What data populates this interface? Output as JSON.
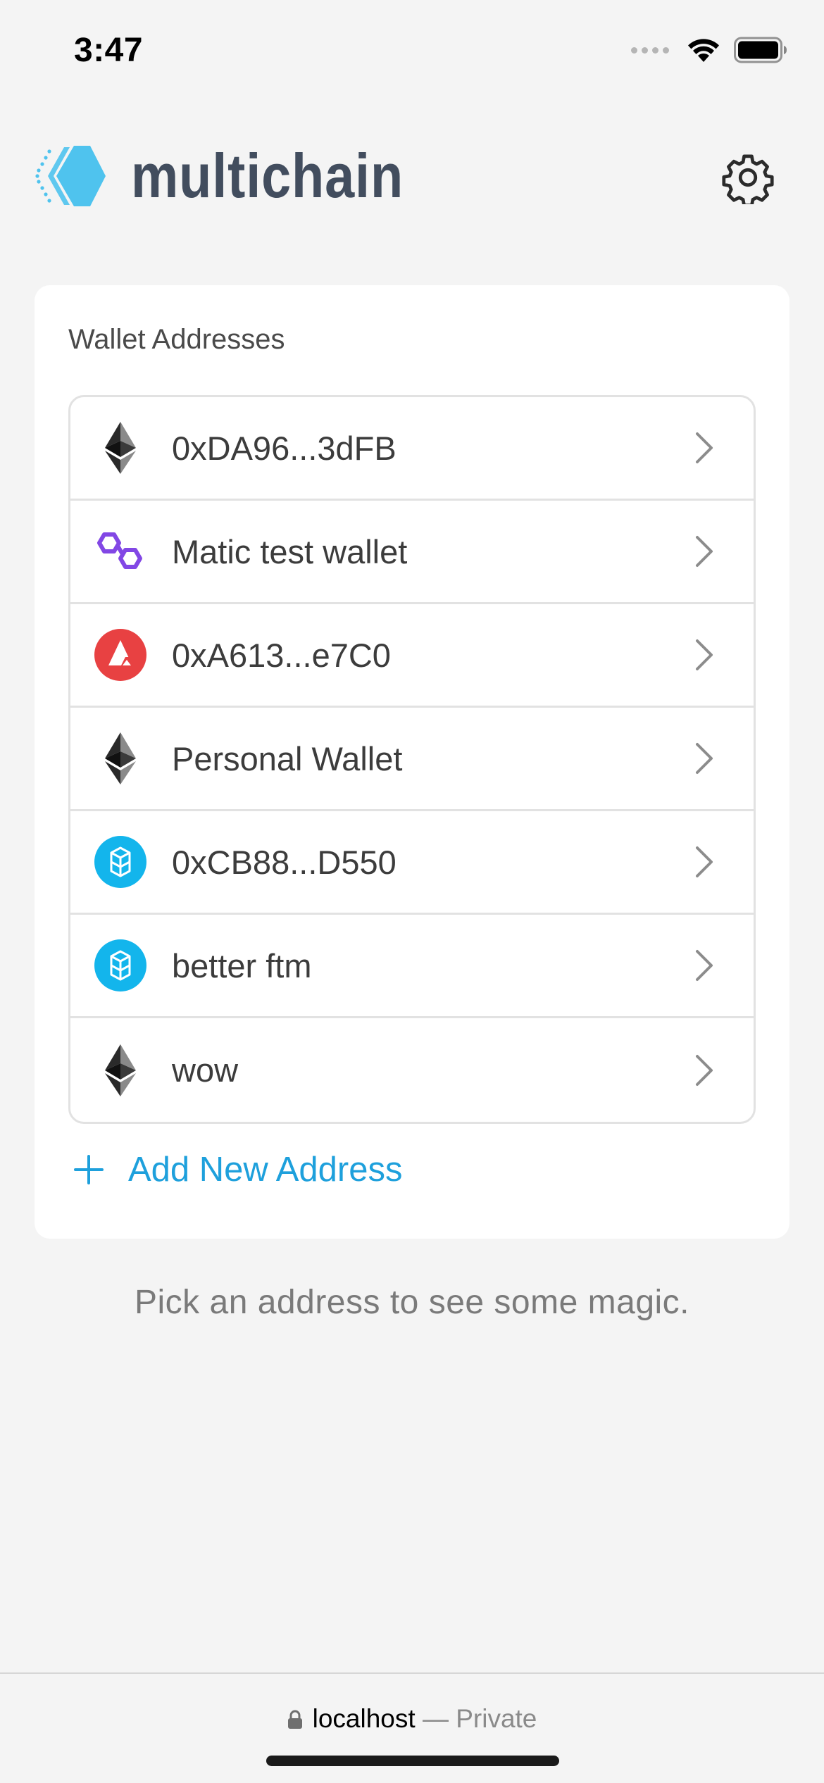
{
  "status_bar": {
    "time": "3:47"
  },
  "header": {
    "app_name": "multichain",
    "logo_color": "#4fc3ee",
    "text_color": "#424d5e"
  },
  "card": {
    "title": "Wallet Addresses",
    "wallets": [
      {
        "label": "0xDA96...3dFB",
        "chain_icon": "ethereum-icon"
      },
      {
        "label": "Matic test wallet",
        "chain_icon": "polygon-icon"
      },
      {
        "label": "0xA613...e7C0",
        "chain_icon": "avalanche-icon"
      },
      {
        "label": "Personal Wallet",
        "chain_icon": "ethereum-icon"
      },
      {
        "label": "0xCB88...D550",
        "chain_icon": "fantom-icon"
      },
      {
        "label": "better ftm",
        "chain_icon": "fantom-icon"
      },
      {
        "label": "wow",
        "chain_icon": "ethereum-icon"
      }
    ],
    "add_button": {
      "label": "Add New Address",
      "color": "#1ea0dc"
    }
  },
  "hint": "Pick an address to see some magic.",
  "browser_bar": {
    "host": "localhost",
    "privacy": "— Private"
  }
}
